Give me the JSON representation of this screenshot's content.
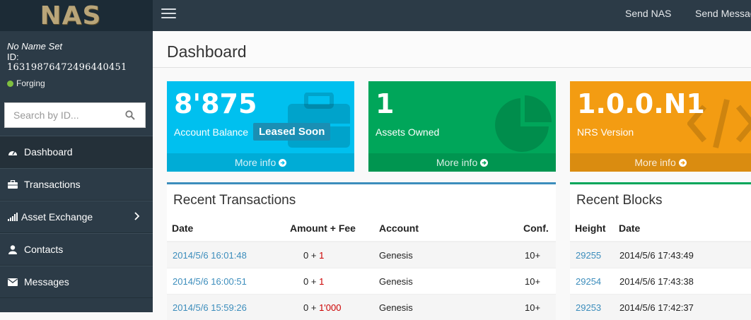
{
  "brand": {
    "logo": "NAS"
  },
  "user": {
    "name": "No Name Set",
    "id_label": "ID:",
    "id": "16319876472496440451",
    "status": "Forging"
  },
  "search": {
    "placeholder": "Search by ID..."
  },
  "menu": [
    {
      "label": "Dashboard",
      "icon": "dashboard-icon"
    },
    {
      "label": "Transactions",
      "icon": "briefcase-icon"
    },
    {
      "label": "Asset Exchange",
      "icon": "signal-icon"
    },
    {
      "label": "Contacts",
      "icon": "user-icon"
    },
    {
      "label": "Messages",
      "icon": "envelope-icon"
    }
  ],
  "topbar": {
    "send_nas": "Send NAS",
    "send_message": "Send Message"
  },
  "page_title": "Dashboard",
  "boxes": [
    {
      "value": "8'875",
      "label": "Account Balance",
      "badge": "Leased Soon",
      "more": "More info",
      "color": "#00c0ef"
    },
    {
      "value": "1",
      "label": "Assets Owned",
      "more": "More info",
      "color": "#00a65a"
    },
    {
      "value": "1.0.0.N1",
      "label": "NRS Version",
      "more": "More info",
      "color": "#f39c12"
    }
  ],
  "recent_transactions": {
    "title": "Recent Transactions",
    "headers": [
      "Date",
      "Amount + Fee",
      "Account",
      "Conf."
    ],
    "rows": [
      {
        "date": "2014/5/6 16:01:48",
        "amount": "0",
        "plus": "+",
        "fee": "1",
        "account": "Genesis",
        "conf": "10+"
      },
      {
        "date": "2014/5/6 16:00:51",
        "amount": "0",
        "plus": "+",
        "fee": "1",
        "account": "Genesis",
        "conf": "10+"
      },
      {
        "date": "2014/5/6 15:59:26",
        "amount": "0",
        "plus": "+",
        "fee": "1'000",
        "account": "Genesis",
        "conf": "10+"
      }
    ]
  },
  "recent_blocks": {
    "title": "Recent Blocks",
    "headers": [
      "Height",
      "Date"
    ],
    "rows": [
      {
        "height": "29255",
        "date": "2014/5/6 17:43:49"
      },
      {
        "height": "29254",
        "date": "2014/5/6 17:43:38"
      },
      {
        "height": "29253",
        "date": "2014/5/6 17:42:37"
      }
    ]
  }
}
